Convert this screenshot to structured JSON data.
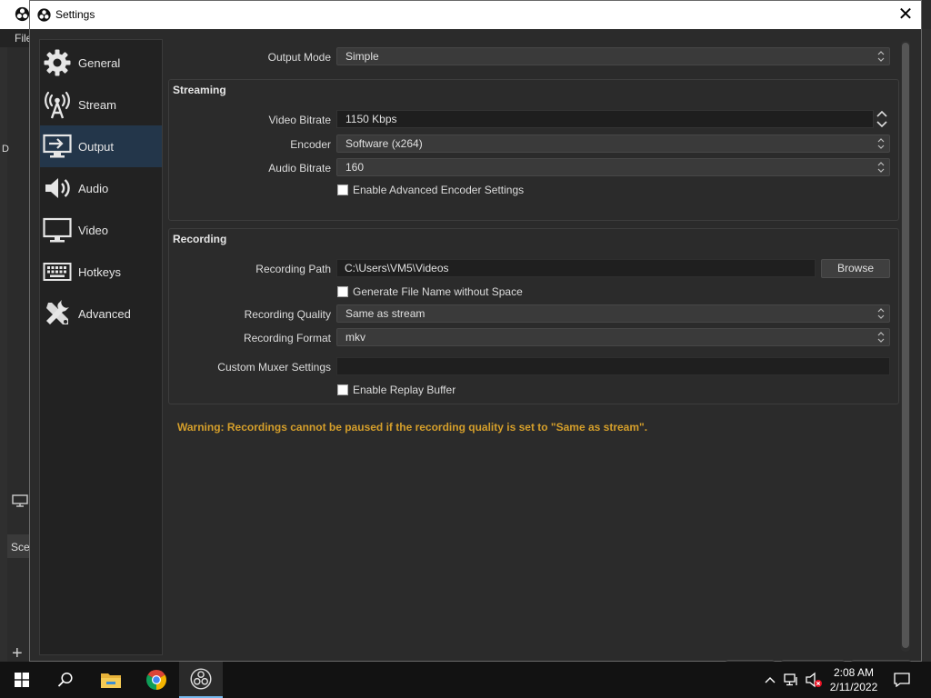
{
  "background_app": {
    "menu_file": "File",
    "left_label": "D",
    "scenes_label": "Scenes"
  },
  "dialog": {
    "title": "Settings",
    "close_glyph": "✕"
  },
  "nav": {
    "items": [
      {
        "label": "General",
        "icon": "gear-icon"
      },
      {
        "label": "Stream",
        "icon": "antenna-icon"
      },
      {
        "label": "Output",
        "icon": "output-monitor-icon",
        "active": true
      },
      {
        "label": "Audio",
        "icon": "speaker-icon"
      },
      {
        "label": "Video",
        "icon": "monitor-icon"
      },
      {
        "label": "Hotkeys",
        "icon": "keyboard-icon"
      },
      {
        "label": "Advanced",
        "icon": "tools-icon"
      }
    ]
  },
  "output": {
    "mode_label": "Output Mode",
    "mode_value": "Simple",
    "streaming": {
      "title": "Streaming",
      "video_bitrate_label": "Video Bitrate",
      "video_bitrate_value": "1150 Kbps",
      "encoder_label": "Encoder",
      "encoder_value": "Software (x264)",
      "audio_bitrate_label": "Audio Bitrate",
      "audio_bitrate_value": "160",
      "advanced_encoder_label": "Enable Advanced Encoder Settings",
      "advanced_encoder_checked": false
    },
    "recording": {
      "title": "Recording",
      "path_label": "Recording Path",
      "path_value": "C:\\Users\\VM5\\Videos",
      "browse_label": "Browse",
      "no_space_label": "Generate File Name without Space",
      "no_space_checked": false,
      "quality_label": "Recording Quality",
      "quality_value": "Same as stream",
      "format_label": "Recording Format",
      "format_value": "mkv",
      "muxer_label": "Custom Muxer Settings",
      "muxer_value": "",
      "replay_label": "Enable Replay Buffer",
      "replay_checked": false
    },
    "warning": "Warning: Recordings cannot be paused if the recording quality is set to \"Same as stream\"."
  },
  "taskbar": {
    "time": "2:08 AM",
    "date": "2/11/2022",
    "apps": [
      "windows-start-icon",
      "search-icon",
      "file-explorer-icon",
      "chrome-icon",
      "obs-icon"
    ],
    "tray": [
      "chevron-up-icon",
      "network-icon",
      "volume-muted-icon",
      "notification-icon"
    ]
  },
  "colors": {
    "active_nav": "#23364a",
    "warning": "#d59f2b",
    "taskbar_active_underline": "#76b9ed"
  }
}
